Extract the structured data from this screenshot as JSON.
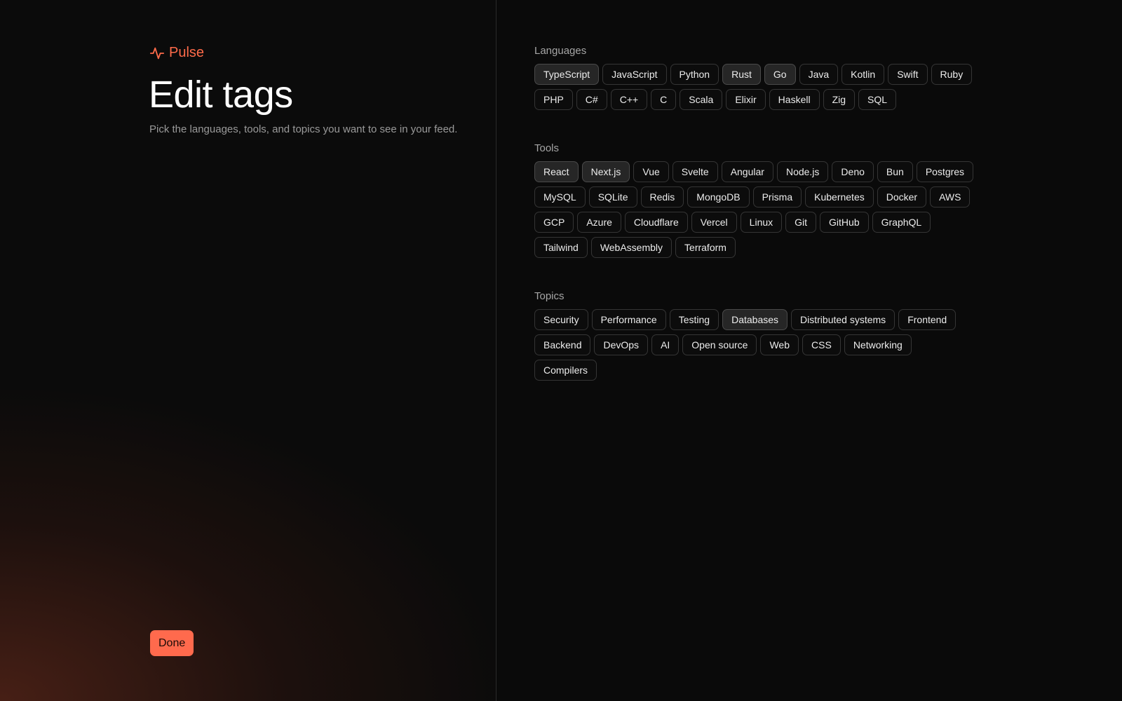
{
  "brand": {
    "name": "Pulse",
    "icon": "pulse-icon",
    "color": "#ff6b4a"
  },
  "header": {
    "title": "Edit tags",
    "subtitle": "Pick the languages, tools, and topics you want to see in your feed."
  },
  "actions": {
    "done_label": "Done",
    "done_color": "#ff6a4d"
  },
  "sections": [
    {
      "id": "languages",
      "title": "Languages",
      "tags": [
        {
          "label": "TypeScript",
          "selected": true
        },
        {
          "label": "JavaScript",
          "selected": false
        },
        {
          "label": "Python",
          "selected": false
        },
        {
          "label": "Rust",
          "selected": true
        },
        {
          "label": "Go",
          "selected": true
        },
        {
          "label": "Java",
          "selected": false
        },
        {
          "label": "Kotlin",
          "selected": false
        },
        {
          "label": "Swift",
          "selected": false
        },
        {
          "label": "Ruby",
          "selected": false
        },
        {
          "label": "PHP",
          "selected": false
        },
        {
          "label": "C#",
          "selected": false
        },
        {
          "label": "C++",
          "selected": false
        },
        {
          "label": "C",
          "selected": false
        },
        {
          "label": "Scala",
          "selected": false
        },
        {
          "label": "Elixir",
          "selected": false
        },
        {
          "label": "Haskell",
          "selected": false
        },
        {
          "label": "Zig",
          "selected": false
        },
        {
          "label": "SQL",
          "selected": false
        }
      ]
    },
    {
      "id": "tools",
      "title": "Tools",
      "tags": [
        {
          "label": "React",
          "selected": true
        },
        {
          "label": "Next.js",
          "selected": true
        },
        {
          "label": "Vue",
          "selected": false
        },
        {
          "label": "Svelte",
          "selected": false
        },
        {
          "label": "Angular",
          "selected": false
        },
        {
          "label": "Node.js",
          "selected": false
        },
        {
          "label": "Deno",
          "selected": false
        },
        {
          "label": "Bun",
          "selected": false
        },
        {
          "label": "Postgres",
          "selected": false
        },
        {
          "label": "MySQL",
          "selected": false
        },
        {
          "label": "SQLite",
          "selected": false
        },
        {
          "label": "Redis",
          "selected": false
        },
        {
          "label": "MongoDB",
          "selected": false
        },
        {
          "label": "Prisma",
          "selected": false
        },
        {
          "label": "Kubernetes",
          "selected": false
        },
        {
          "label": "Docker",
          "selected": false
        },
        {
          "label": "AWS",
          "selected": false
        },
        {
          "label": "GCP",
          "selected": false
        },
        {
          "label": "Azure",
          "selected": false
        },
        {
          "label": "Cloudflare",
          "selected": false
        },
        {
          "label": "Vercel",
          "selected": false
        },
        {
          "label": "Linux",
          "selected": false
        },
        {
          "label": "Git",
          "selected": false
        },
        {
          "label": "GitHub",
          "selected": false
        },
        {
          "label": "GraphQL",
          "selected": false
        },
        {
          "label": "Tailwind",
          "selected": false
        },
        {
          "label": "WebAssembly",
          "selected": false
        },
        {
          "label": "Terraform",
          "selected": false
        }
      ]
    },
    {
      "id": "topics",
      "title": "Topics",
      "tags": [
        {
          "label": "Security",
          "selected": false
        },
        {
          "label": "Performance",
          "selected": false
        },
        {
          "label": "Testing",
          "selected": false
        },
        {
          "label": "Databases",
          "selected": true
        },
        {
          "label": "Distributed systems",
          "selected": false
        },
        {
          "label": "Frontend",
          "selected": false
        },
        {
          "label": "Backend",
          "selected": false
        },
        {
          "label": "DevOps",
          "selected": false
        },
        {
          "label": "AI",
          "selected": false
        },
        {
          "label": "Open source",
          "selected": false
        },
        {
          "label": "Web",
          "selected": false
        },
        {
          "label": "CSS",
          "selected": false
        },
        {
          "label": "Networking",
          "selected": false
        },
        {
          "label": "Compilers",
          "selected": false
        }
      ]
    }
  ]
}
